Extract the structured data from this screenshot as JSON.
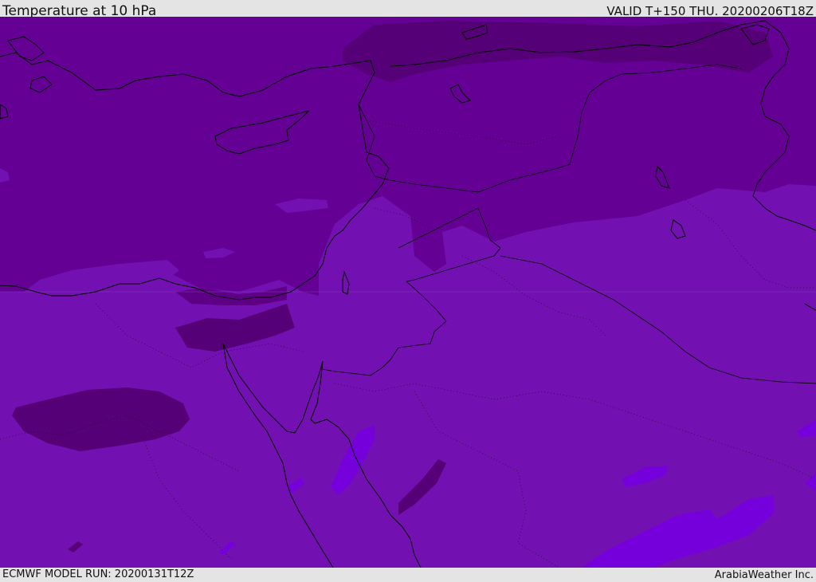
{
  "header": {
    "title": "Temperature at 10 hPa",
    "valid_time": "VALID T+150 THU. 20200206T18Z"
  },
  "footer": {
    "model_run": "ECMWF MODEL RUN: 20200131T12Z",
    "credit": "ArabiaWeather Inc."
  },
  "map": {
    "field": "Temperature",
    "level": "10 hPa",
    "colors": {
      "coldest": "#560078",
      "cold": "#640094",
      "mid": "#7310b1",
      "warm": "#7600dc",
      "coastline": "#000000"
    }
  }
}
